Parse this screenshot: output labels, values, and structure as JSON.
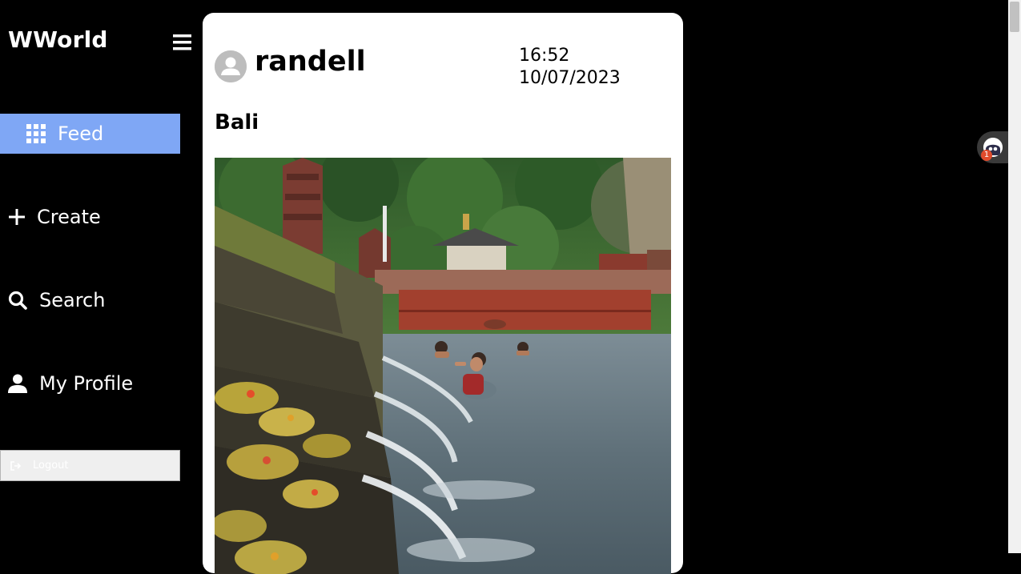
{
  "sidebar": {
    "brand": "WWorld",
    "nav": {
      "feed": "Feed",
      "create": "Create",
      "search": "Search",
      "profile": "My Profile"
    },
    "logout_label": "Logout",
    "active_item": "feed",
    "active_color": "#7fa7f5"
  },
  "post": {
    "username": "randell",
    "time": "16:52",
    "date": "10/07/2023",
    "title": "Bali"
  },
  "extension": {
    "badge_count": "1"
  },
  "icons": {
    "menu": "hamburger-menu-icon",
    "feed": "grid-icon",
    "create": "plus-icon",
    "search": "search-icon",
    "profile": "user-icon",
    "logout": "sign-out-icon",
    "avatar": "default-avatar-icon"
  }
}
